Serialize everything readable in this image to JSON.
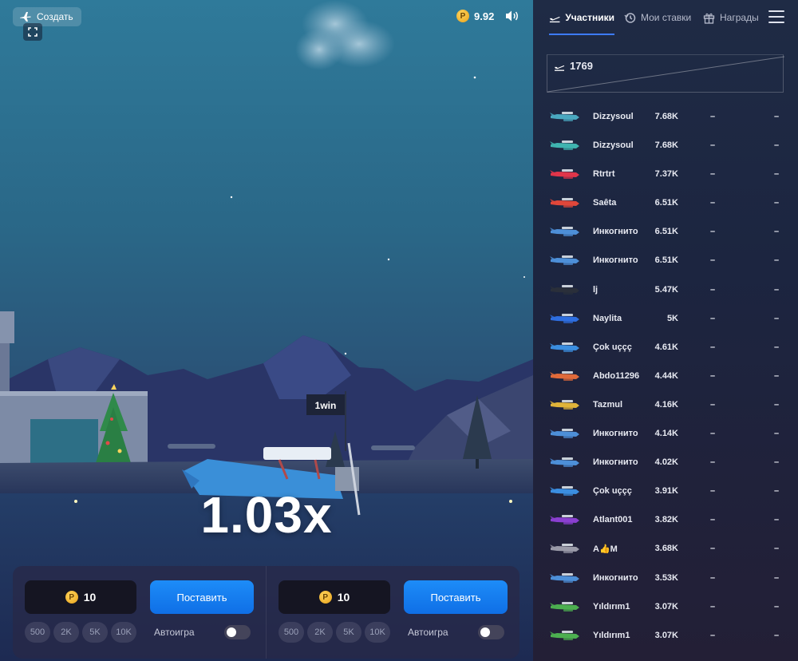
{
  "header": {
    "create_label": "Создать",
    "balance_value": "9.92",
    "coin_symbol": "P"
  },
  "game": {
    "multiplier": "1.03x",
    "flag_text": "1win"
  },
  "bets": [
    {
      "amount": "10",
      "place_label": "Поставить",
      "chips": [
        "500",
        "2K",
        "5K",
        "10K"
      ],
      "autoplay_label": "Автоигра",
      "autoplay_on": false
    },
    {
      "amount": "10",
      "place_label": "Поставить",
      "chips": [
        "500",
        "2K",
        "5K",
        "10K"
      ],
      "autoplay_label": "Автоигра",
      "autoplay_on": false
    }
  ],
  "sidebar": {
    "tabs": [
      {
        "label": "Участники",
        "icon": "plane-takeoff-icon",
        "active": true
      },
      {
        "label": "Мои ставки",
        "icon": "history-icon",
        "active": false
      },
      {
        "label": "Награды",
        "icon": "gift-icon",
        "active": false
      }
    ],
    "participants_count": "1769",
    "players": [
      {
        "name": "Dizzysoul",
        "bet": "7.68K",
        "multiplier": "–",
        "win": "–",
        "color": "#4aa8c0"
      },
      {
        "name": "Dizzysoul",
        "bet": "7.68K",
        "multiplier": "–",
        "win": "–",
        "color": "#3fb4b0"
      },
      {
        "name": "Rtrtrt",
        "bet": "7.37K",
        "multiplier": "–",
        "win": "–",
        "color": "#e0354a"
      },
      {
        "name": "Saêta",
        "bet": "6.51K",
        "multiplier": "–",
        "win": "–",
        "color": "#e0473a"
      },
      {
        "name": "Инкогнито",
        "bet": "6.51K",
        "multiplier": "–",
        "win": "–",
        "color": "#4d8fd8"
      },
      {
        "name": "Инкогнито",
        "bet": "6.51K",
        "multiplier": "–",
        "win": "–",
        "color": "#4d8fd8"
      },
      {
        "name": "lj",
        "bet": "5.47K",
        "multiplier": "–",
        "win": "–",
        "color": "#2a2f3a"
      },
      {
        "name": "Naylita",
        "bet": "5K",
        "multiplier": "–",
        "win": "–",
        "color": "#2e6ee0"
      },
      {
        "name": "Çok uççç",
        "bet": "4.61K",
        "multiplier": "–",
        "win": "–",
        "color": "#3b8ee0"
      },
      {
        "name": "Abdo11296",
        "bet": "4.44K",
        "multiplier": "–",
        "win": "–",
        "color": "#e06a3a"
      },
      {
        "name": "Tazmul",
        "bet": "4.16K",
        "multiplier": "–",
        "win": "–",
        "color": "#e0b43a"
      },
      {
        "name": "Инкогнито",
        "bet": "4.14K",
        "multiplier": "–",
        "win": "–",
        "color": "#4d8fd8"
      },
      {
        "name": "Инкогнито",
        "bet": "4.02K",
        "multiplier": "–",
        "win": "–",
        "color": "#4d8fd8"
      },
      {
        "name": "Çok uççç",
        "bet": "3.91K",
        "multiplier": "–",
        "win": "–",
        "color": "#3b8ee0"
      },
      {
        "name": "Atlant001",
        "bet": "3.82K",
        "multiplier": "–",
        "win": "–",
        "color": "#8a3fd0"
      },
      {
        "name": "A👍M",
        "bet": "3.68K",
        "multiplier": "–",
        "win": "–",
        "color": "#9a9aa8"
      },
      {
        "name": "Инкогнито",
        "bet": "3.53K",
        "multiplier": "–",
        "win": "–",
        "color": "#4d8fd8"
      },
      {
        "name": "Yıldırım1",
        "bet": "3.07K",
        "multiplier": "–",
        "win": "–",
        "color": "#4caf50"
      },
      {
        "name": "Yıldırım1",
        "bet": "3.07K",
        "multiplier": "–",
        "win": "–",
        "color": "#4caf50"
      }
    ]
  }
}
